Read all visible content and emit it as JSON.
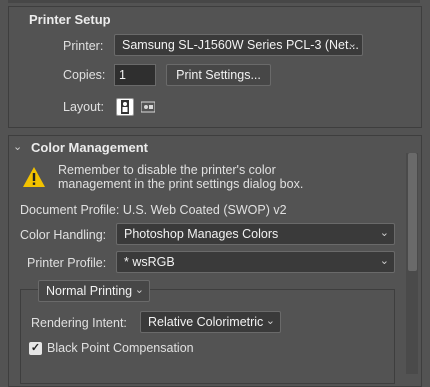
{
  "printer_setup": {
    "title": "Printer Setup",
    "printer_label": "Printer:",
    "printer_value": "Samsung SL-J1560W Series PCL-3 (Net...",
    "copies_label": "Copies:",
    "copies_value": "1",
    "print_settings_label": "Print Settings...",
    "layout_label": "Layout:",
    "layout_icons": [
      "portrait-layout-icon",
      "landscape-layout-icon"
    ]
  },
  "color_management": {
    "title": "Color Management",
    "warning_line1": "Remember to disable the printer's color",
    "warning_line2": "management in the print settings dialog box.",
    "document_profile_label": "Document Profile: U.S. Web Coated (SWOP) v2",
    "color_handling_label": "Color Handling:",
    "color_handling_value": "Photoshop Manages Colors",
    "printer_profile_label": "Printer Profile:",
    "printer_profile_value": "* wsRGB",
    "printing_mode_value": "Normal Printing",
    "rendering_intent_label": "Rendering Intent:",
    "rendering_intent_value": "Relative Colorimetric",
    "black_point_label": "Black Point Compensation",
    "black_point_checked": true
  },
  "colors": {
    "panel_bg": "#535353",
    "control_bg": "#3a3a3a",
    "warning_yellow": "#f2c200"
  }
}
